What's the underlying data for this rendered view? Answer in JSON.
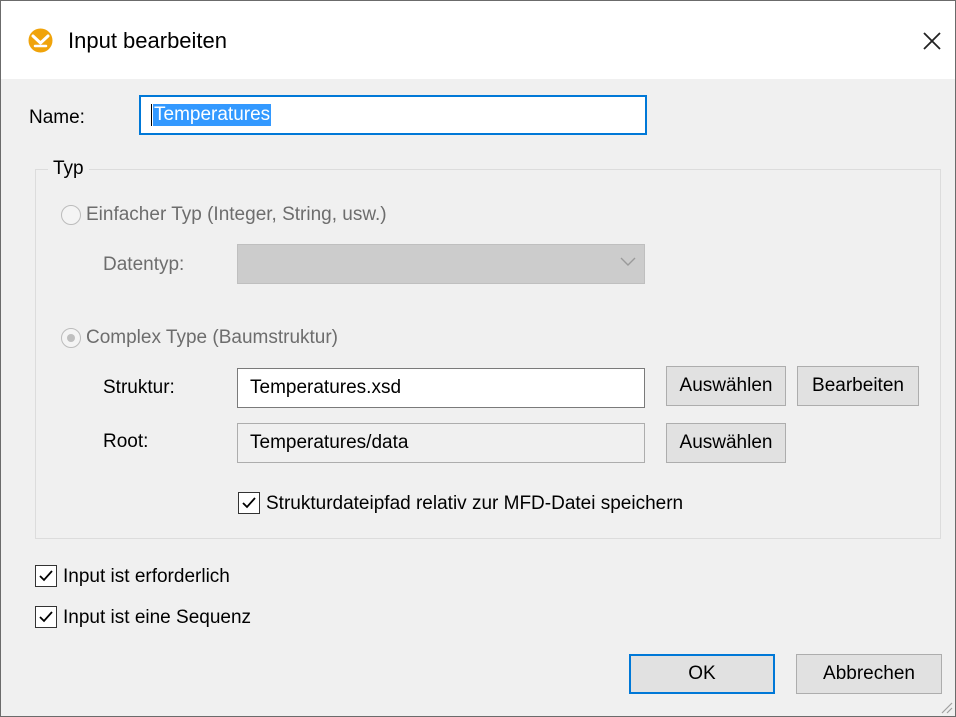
{
  "window": {
    "title": "Input bearbeiten"
  },
  "name_field": {
    "label": "Name:",
    "value": "Temperatures"
  },
  "type_group": {
    "label": "Typ",
    "simple_type": {
      "label": "Einfacher Typ (Integer, String, usw.)",
      "selected": false,
      "enabled": false
    },
    "datatype": {
      "label": "Datentyp:",
      "value": ""
    },
    "complex_type": {
      "label": "Complex Type (Baumstruktur)",
      "selected": true,
      "enabled": false
    },
    "structure": {
      "label": "Struktur:",
      "value": "Temperatures.xsd",
      "select_button": "Auswählen",
      "edit_button": "Bearbeiten"
    },
    "root": {
      "label": "Root:",
      "value": "Temperatures/data",
      "select_button": "Auswählen"
    },
    "relative_path": {
      "label": "Strukturdateipfad relativ zur MFD-Datei speichern",
      "checked": true
    }
  },
  "required": {
    "label": "Input ist erforderlich",
    "checked": true
  },
  "sequence": {
    "label": "Input ist eine Sequenz",
    "checked": true
  },
  "buttons": {
    "ok": "OK",
    "cancel": "Abbrechen"
  },
  "icons": {
    "app": "mapforce-logo-icon",
    "close": "close-icon",
    "dropdown": "chevron-down-icon",
    "check": "checkmark-icon"
  },
  "colors": {
    "accent": "#0078d7",
    "selection": "#3399ff",
    "logo": "#f0a30a"
  }
}
